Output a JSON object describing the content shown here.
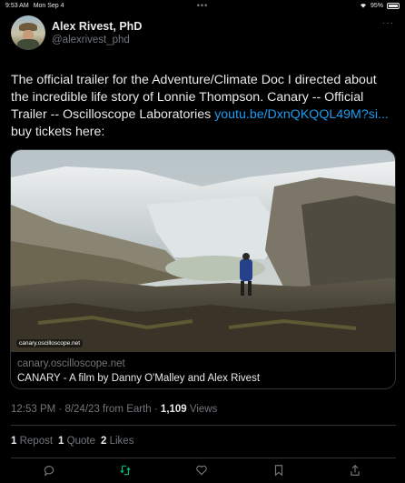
{
  "status_bar": {
    "time": "9:53 AM",
    "date": "Mon Sep 4",
    "dots": "•••",
    "battery": "95%"
  },
  "author": {
    "name": "Alex Rivest, PhD",
    "handle": "@alexrivest_phd"
  },
  "tweet": {
    "text_before_link": "The official trailer for the Adventure/Climate Doc I directed about the incredible life story of Lonnie Thompson. Canary -- Official Trailer -- Oscilloscope Laboratories ",
    "link": "youtu.be/DxnQKQQL49M?si...",
    "text_after_link": " buy tickets here:"
  },
  "card": {
    "overlay_domain": "canary.oscilloscope.net",
    "domain": "canary.oscilloscope.net",
    "title": "CANARY - A film by Danny O'Malley and Alex Rivest"
  },
  "meta": {
    "time_date": "12:53 PM · 8/24/23 from Earth · ",
    "views_count": "1,109",
    "views_label": " Views"
  },
  "stats": {
    "reposts_count": "1",
    "reposts_label": "Repost",
    "quotes_count": "1",
    "quotes_label": "Quote",
    "likes_count": "2",
    "likes_label": "Likes"
  },
  "colors": {
    "background": "#000000",
    "text": "#e7e9ea",
    "secondary": "#71767b",
    "link": "#1d9bf0",
    "repost_active": "#00ba7c",
    "border": "#2f3336"
  },
  "actions": [
    "reply-icon",
    "repost-icon",
    "like-icon",
    "bookmark-icon",
    "share-icon"
  ]
}
